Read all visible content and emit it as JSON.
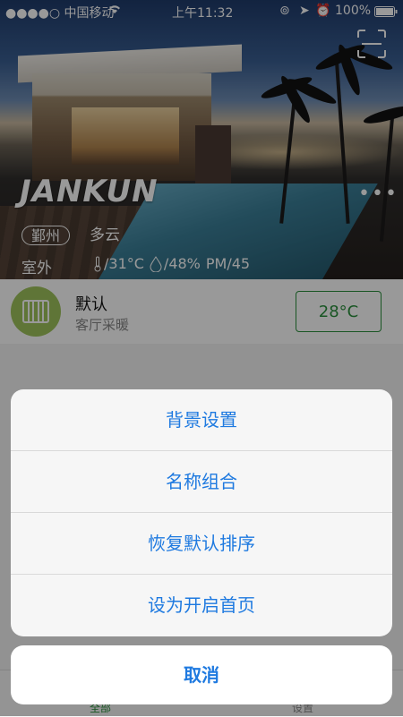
{
  "status_bar": {
    "carrier": "●●●●○ 中国移动",
    "time": "上午11:32",
    "battery": "100%"
  },
  "header": {
    "brand": "JANKUN",
    "city": "鄞州",
    "weather": "多云",
    "outdoor_label": "室外",
    "temperature": "/31°C",
    "humidity": "/48%",
    "pm": "PM/45"
  },
  "device": {
    "name": "默认",
    "room": "客厅采暖",
    "temperature": "28°C"
  },
  "tabs": {
    "all": "全部",
    "settings": "设置"
  },
  "action_sheet": {
    "items": [
      "背景设置",
      "名称组合",
      "恢复默认排序",
      "设为开启首页"
    ],
    "cancel": "取消"
  },
  "colors": {
    "accent_green": "#2a8f3c",
    "sheet_blue": "#1f7ae0"
  }
}
